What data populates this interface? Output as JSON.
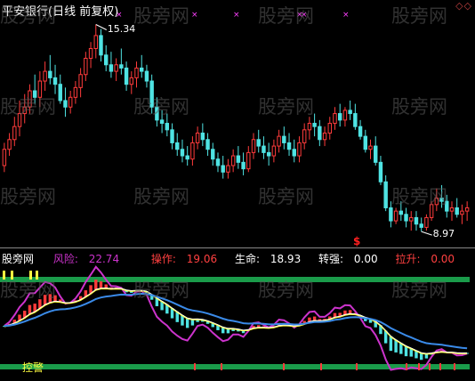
{
  "header": {
    "title": "平安银行(日线 前复权)",
    "corner_marks": "◇◇"
  },
  "watermarks": [
    "股旁网",
    "股旁网",
    "股旁网",
    "股旁网",
    "股旁网",
    "股旁网",
    "股旁网",
    "股旁网",
    "股旁网",
    "股旁网",
    "股旁网",
    "股旁网"
  ],
  "indicator": {
    "name": "股旁网",
    "risk_label": "风险:",
    "risk_value": "22.74",
    "op_label": "操作:",
    "op_value": "19.06",
    "life_label": "生命:",
    "life_value": "18.93",
    "strong_label": "转强:",
    "strong_value": "0.00",
    "lift_label": "拉升:",
    "lift_value": "0.00",
    "bottom_label": "控警",
    "signal_mark": "$"
  },
  "colors": {
    "up": "#ff3b3b",
    "down": "#4fe3e3",
    "risk": "#cc33cc",
    "life": "#ffffff",
    "op": "#ffff40",
    "band": "#1a9b4a",
    "trend_blue": "#3a8ae8"
  },
  "chart_data": {
    "type": "candlestick",
    "high_label": "15.34",
    "low_label": "8.97",
    "ylim": [
      8.7,
      15.6
    ],
    "candles": [
      [
        11.0,
        11.7,
        10.8,
        11.5
      ],
      [
        11.5,
        12.0,
        11.3,
        11.8
      ],
      [
        11.8,
        12.5,
        11.6,
        12.2
      ],
      [
        12.2,
        13.0,
        11.9,
        12.6
      ],
      [
        12.6,
        13.2,
        12.3,
        12.8
      ],
      [
        12.8,
        13.5,
        12.6,
        13.3
      ],
      [
        13.3,
        13.8,
        12.9,
        13.1
      ],
      [
        13.1,
        13.9,
        12.8,
        13.6
      ],
      [
        13.6,
        14.2,
        13.3,
        13.9
      ],
      [
        13.9,
        14.4,
        13.5,
        13.7
      ],
      [
        13.7,
        14.1,
        13.2,
        13.5
      ],
      [
        13.5,
        13.8,
        12.9,
        13.0
      ],
      [
        13.0,
        13.4,
        12.5,
        12.8
      ],
      [
        12.8,
        13.3,
        12.6,
        13.1
      ],
      [
        13.1,
        13.6,
        12.9,
        13.4
      ],
      [
        13.4,
        14.0,
        13.1,
        13.8
      ],
      [
        13.8,
        14.5,
        13.6,
        14.3
      ],
      [
        14.3,
        14.8,
        14.0,
        14.6
      ],
      [
        14.6,
        15.34,
        14.3,
        15.0
      ],
      [
        15.0,
        15.2,
        14.2,
        14.4
      ],
      [
        14.4,
        14.7,
        13.9,
        14.1
      ],
      [
        14.1,
        14.5,
        13.7,
        13.9
      ],
      [
        13.9,
        14.3,
        13.6,
        14.1
      ],
      [
        14.1,
        14.6,
        13.8,
        14.0
      ],
      [
        14.0,
        14.2,
        13.3,
        13.5
      ],
      [
        13.5,
        13.9,
        13.2,
        13.7
      ],
      [
        13.7,
        14.2,
        13.4,
        14.0
      ],
      [
        14.0,
        14.4,
        13.7,
        13.9
      ],
      [
        13.9,
        14.1,
        13.4,
        13.6
      ],
      [
        13.6,
        13.8,
        12.6,
        12.8
      ],
      [
        12.8,
        13.1,
        12.2,
        12.4
      ],
      [
        12.4,
        12.7,
        12.0,
        12.3
      ],
      [
        12.3,
        12.6,
        11.9,
        12.1
      ],
      [
        12.1,
        12.3,
        11.5,
        11.7
      ],
      [
        11.7,
        12.0,
        11.3,
        11.5
      ],
      [
        11.5,
        11.8,
        11.1,
        11.3
      ],
      [
        11.3,
        11.6,
        11.0,
        11.2
      ],
      [
        11.2,
        11.9,
        11.0,
        11.7
      ],
      [
        11.7,
        12.2,
        11.5,
        12.0
      ],
      [
        12.0,
        12.3,
        11.6,
        11.8
      ],
      [
        11.8,
        12.0,
        11.3,
        11.5
      ],
      [
        11.5,
        11.7,
        11.0,
        11.2
      ],
      [
        11.2,
        11.4,
        10.8,
        11.0
      ],
      [
        11.0,
        11.3,
        10.6,
        10.8
      ],
      [
        10.8,
        11.2,
        10.6,
        11.0
      ],
      [
        11.0,
        11.5,
        10.8,
        11.3
      ],
      [
        11.3,
        11.6,
        10.9,
        11.1
      ],
      [
        11.1,
        11.4,
        10.7,
        10.9
      ],
      [
        10.9,
        11.6,
        10.8,
        11.4
      ],
      [
        11.4,
        12.0,
        11.2,
        11.8
      ],
      [
        11.8,
        12.1,
        11.4,
        11.6
      ],
      [
        11.6,
        11.9,
        11.2,
        11.4
      ],
      [
        11.4,
        11.7,
        11.0,
        11.3
      ],
      [
        11.3,
        11.8,
        11.1,
        11.6
      ],
      [
        11.6,
        12.1,
        11.4,
        11.9
      ],
      [
        11.9,
        12.2,
        11.5,
        11.7
      ],
      [
        11.7,
        12.0,
        11.3,
        11.5
      ],
      [
        11.5,
        11.8,
        11.1,
        11.3
      ],
      [
        11.3,
        11.9,
        11.1,
        11.7
      ],
      [
        11.7,
        12.3,
        11.5,
        12.1
      ],
      [
        12.1,
        12.5,
        11.8,
        12.3
      ],
      [
        12.3,
        12.6,
        11.9,
        12.2
      ],
      [
        12.2,
        12.4,
        11.6,
        11.8
      ],
      [
        11.8,
        12.2,
        11.6,
        12.0
      ],
      [
        12.0,
        12.5,
        11.8,
        12.3
      ],
      [
        12.3,
        12.8,
        12.1,
        12.6
      ],
      [
        12.6,
        12.9,
        12.2,
        12.4
      ],
      [
        12.4,
        12.8,
        12.2,
        12.7
      ],
      [
        12.7,
        13.0,
        12.4,
        12.6
      ],
      [
        12.6,
        12.9,
        12.1,
        12.2
      ],
      [
        12.2,
        12.4,
        11.8,
        11.9
      ],
      [
        11.9,
        12.1,
        11.4,
        11.5
      ],
      [
        11.5,
        11.8,
        11.2,
        11.6
      ],
      [
        11.6,
        11.9,
        11.0,
        11.1
      ],
      [
        11.1,
        11.3,
        10.4,
        10.5
      ],
      [
        10.5,
        10.7,
        9.6,
        9.7
      ],
      [
        9.7,
        9.9,
        9.1,
        9.3
      ],
      [
        9.3,
        9.7,
        9.2,
        9.6
      ],
      [
        9.6,
        9.9,
        9.3,
        9.5
      ],
      [
        9.5,
        9.7,
        9.1,
        9.3
      ],
      [
        9.3,
        9.6,
        9.0,
        9.4
      ],
      [
        9.4,
        9.6,
        9.0,
        9.2
      ],
      [
        9.2,
        9.4,
        8.97,
        9.1
      ],
      [
        9.1,
        9.5,
        9.0,
        9.4
      ],
      [
        9.4,
        9.9,
        9.3,
        9.8
      ],
      [
        9.8,
        10.3,
        9.6,
        10.0
      ],
      [
        10.0,
        10.4,
        9.7,
        9.9
      ],
      [
        9.9,
        10.1,
        9.4,
        9.6
      ],
      [
        9.6,
        9.9,
        9.3,
        9.7
      ],
      [
        9.7,
        10.0,
        9.4,
        9.5
      ],
      [
        9.5,
        9.8,
        9.2,
        9.6
      ],
      [
        9.6,
        9.9,
        9.3,
        9.7
      ]
    ]
  }
}
